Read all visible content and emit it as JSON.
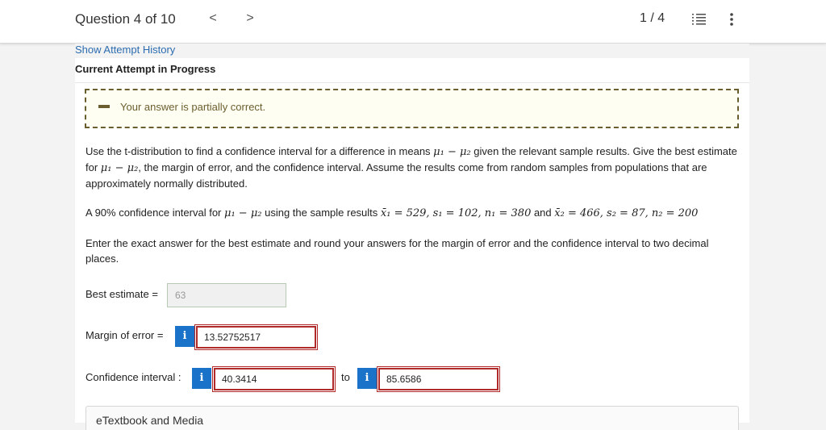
{
  "header": {
    "question_title": "Question 4 of 10",
    "prev_glyph": "<",
    "next_glyph": ">",
    "pager": "1 / 4"
  },
  "attempt": {
    "history_link": "Show Attempt History",
    "current_label": "Current Attempt in Progress"
  },
  "feedback": {
    "message": "Your answer is partially correct.",
    "color": "#6b5e2e"
  },
  "question": {
    "instructions_1": "Use the t-distribution to find a confidence interval for a difference in means ",
    "mu_expr_1": "μ₁ − μ₂",
    "instructions_2": " given the relevant sample results. Give the best estimate for ",
    "mu_expr_2": "μ₁ − μ₂",
    "instructions_3": ", the margin of error, and the confidence interval. Assume the results come from random samples from populations that are approximately normally distributed.",
    "setup_prefix": "A 90% confidence interval for ",
    "setup_mu": "μ₁ − μ₂",
    "setup_mid": " using the sample results ",
    "setup_values_1": "x̄₁ = 529, s₁ = 102, n₁ = 380",
    "setup_and": " and ",
    "setup_values_2": "x̄₂ = 466, s₂ = 87, n₂ = 200",
    "rounding_note": "Enter the exact answer for the best estimate and round your answers for the margin of error and the confidence interval to two decimal places."
  },
  "answers": {
    "best_estimate_label": "Best estimate =",
    "best_estimate_value": "63",
    "margin_label": "Margin of error =",
    "margin_value": "13.52752517",
    "ci_label": "Confidence interval :",
    "ci_lower": "40.3414",
    "ci_to": "to",
    "ci_upper": "85.6586",
    "info_glyph": "i",
    "error_color": "#b02a2a",
    "info_color": "#1a73c8"
  },
  "etext": {
    "label": "eTextbook and Media"
  }
}
